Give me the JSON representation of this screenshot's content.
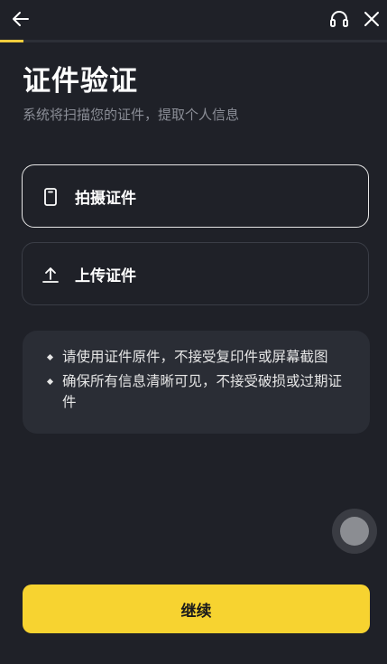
{
  "header": {
    "back_icon": "back-arrow-icon",
    "support_icon": "headset-icon",
    "close_icon": "close-icon",
    "progress_percent": 6
  },
  "page": {
    "title": "证件验证",
    "subtitle": "系统将扫描您的证件，提取个人信息"
  },
  "options": [
    {
      "label": "拍摄证件",
      "icon": "phone-camera-icon",
      "selected": true
    },
    {
      "label": "上传证件",
      "icon": "upload-icon",
      "selected": false
    }
  ],
  "tips": [
    "请使用证件原件，不接受复印件或屏幕截图",
    "确保所有信息清晰可见，不接受破损或过期证件"
  ],
  "footer": {
    "continue_label": "继续"
  },
  "colors": {
    "background": "#1f2128",
    "accent": "#f7d330",
    "card": "#2a2d35"
  }
}
